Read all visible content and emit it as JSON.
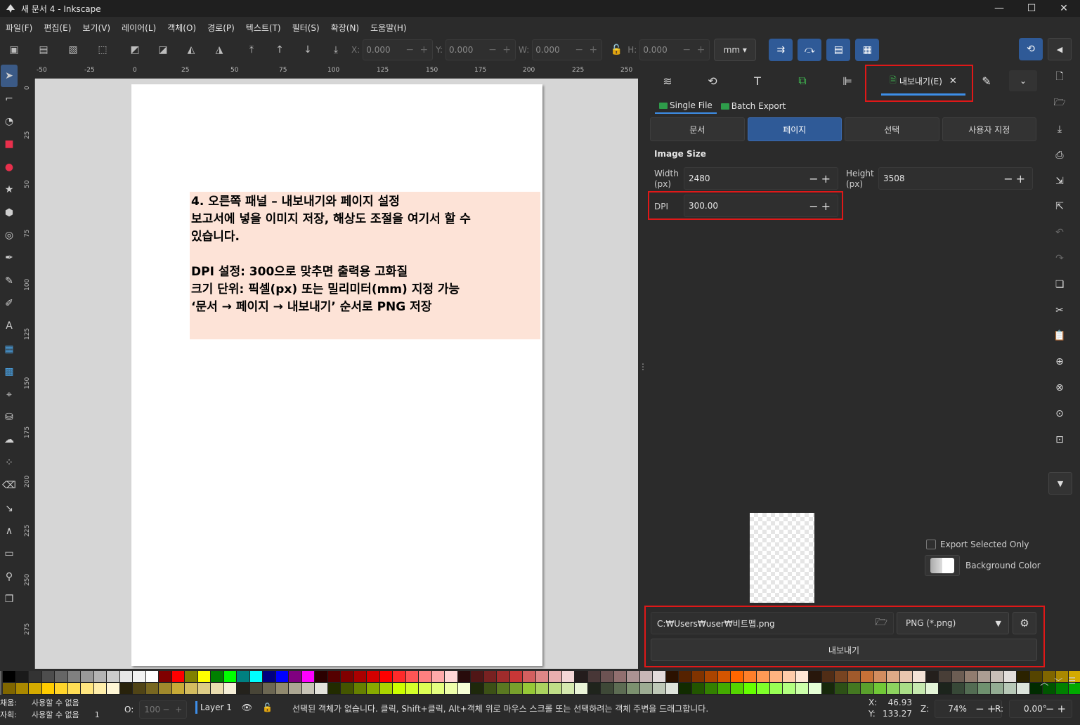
{
  "window": {
    "title": "새 문서 4 - Inkscape",
    "minimize": "—",
    "maximize": "☐",
    "close": "✕"
  },
  "menu": [
    "파일(F)",
    "편집(E)",
    "보기(V)",
    "레이어(L)",
    "객체(O)",
    "경로(P)",
    "텍스트(T)",
    "필터(S)",
    "확장(N)",
    "도움말(H)"
  ],
  "toolbar": {
    "x_label": "X:",
    "x_value": "0.000",
    "y_label": "Y:",
    "y_value": "0.000",
    "w_label": "W:",
    "w_value": "0.000",
    "h_label": "H:",
    "h_value": "0.000",
    "unit": "mm"
  },
  "ruler": {
    "h_ticks": [
      "-50",
      "-25",
      "0",
      "25",
      "50",
      "75",
      "100",
      "125",
      "150",
      "175",
      "200",
      "225",
      "250"
    ],
    "v_ticks": [
      "0",
      "25",
      "50",
      "75",
      "100",
      "125",
      "150",
      "175",
      "200",
      "225",
      "250",
      "275"
    ]
  },
  "canvas_text": {
    "lines": [
      "4. 오른쪽 패널 – 내보내기와 페이지 설정",
      "보고서에 넣을 이미지 저장, 해상도 조절을 여기서 할 수",
      "있습니다.",
      "",
      "DPI 설정: 300으로 맞추면 출력용 고화질",
      "크기 단위: 픽셀(px) 또는 밀리미터(mm) 지정 가능",
      "‘문서 → 페이지 → 내보내기’ 순서로 PNG 저장"
    ]
  },
  "panel": {
    "export_tab_label": "내보내기(E)",
    "subtabs": [
      "Single File",
      "Batch Export"
    ],
    "scope_buttons": [
      "문서",
      "페이지",
      "선택",
      "사용자 지정"
    ],
    "active_scope": "페이지",
    "image_size_title": "Image Size",
    "width_label": "Width",
    "width_unit": "(px)",
    "width_value": "2480",
    "height_label": "Height",
    "height_unit": "(px)",
    "height_value": "3508",
    "dpi_label": "DPI",
    "dpi_value": "300.00",
    "export_selected_only": "Export Selected Only",
    "background_color": "Background Color",
    "filepath": "C:₩Users₩user₩비트맵.png",
    "format": "PNG (*.png)",
    "export_button": "내보내기"
  },
  "status": {
    "fill_label": "채움:",
    "fill_value": "사용할 수 없음",
    "stroke_label": "자획:",
    "stroke_value": "사용할 수 없음",
    "stroke_width": "1",
    "opacity_label": "O:",
    "opacity_value": "100",
    "layer": "Layer 1",
    "message": "선택된 객체가 없습니다. 클릭, Shift+클릭, Alt+객체 위로 마우스 스크롤 또는 선택하려는 객체 주변을 드래그합니다.",
    "x_label": "X:",
    "x_value": "46.93",
    "y_label": "Y:",
    "y_value": "133.27",
    "zoom_label": "Z:",
    "zoom_value": "74%",
    "rotate_label": "R:",
    "rotate_value": "0.00°"
  },
  "colors": {
    "accent": "#2f5a97",
    "highlight": "#e01818",
    "text_bg": "#fde3d7"
  }
}
